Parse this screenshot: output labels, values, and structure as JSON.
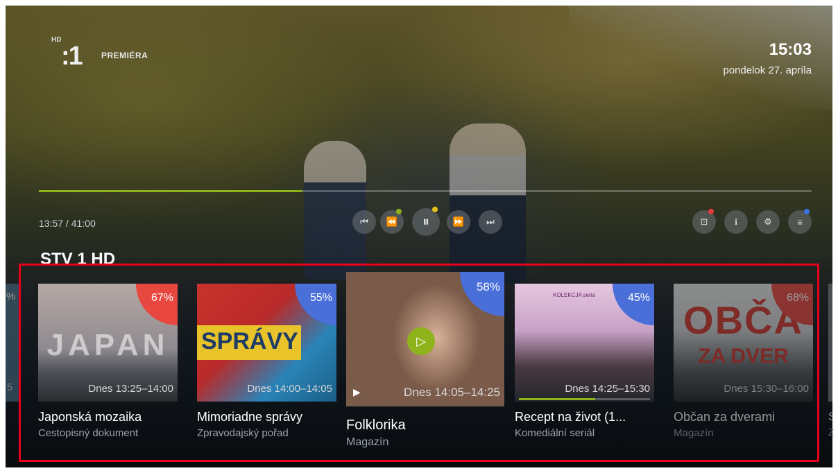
{
  "channel": {
    "hd_badge": "HD",
    "logo": ":1",
    "name": "PREMIÉRA"
  },
  "clock": {
    "time": "15:03",
    "date": "pondelok 27. apríla"
  },
  "player": {
    "position_text": "13:57 / 41:00",
    "progress_fraction": 0.34,
    "controls": [
      {
        "name": "skip-previous-button",
        "glyph": "⏮"
      },
      {
        "name": "rewind-button",
        "glyph": "⏪"
      },
      {
        "name": "pause-button",
        "glyph": "⏸"
      },
      {
        "name": "fast-forward-button",
        "glyph": "⏩"
      },
      {
        "name": "skip-next-button",
        "glyph": "⏭"
      }
    ],
    "right_controls": [
      {
        "name": "record-button",
        "glyph": "⊡",
        "dot_color": "#e23b3b"
      },
      {
        "name": "info-button",
        "glyph": "i"
      },
      {
        "name": "settings-button",
        "glyph": "⚙"
      },
      {
        "name": "menu-button",
        "glyph": "≡",
        "dot_color": "#3a74e0"
      }
    ],
    "dot_colors": {
      "rewind": "#8fb31a",
      "pause": "#e6c21a"
    }
  },
  "section": {
    "title": "STV 1 HD"
  },
  "carousel": {
    "edge_left": {
      "pct": "%",
      "schedule": "5"
    },
    "edge_right": {
      "title": "S",
      "sub": "Z"
    },
    "items": [
      {
        "title": "Japonská mozaika",
        "subtitle": "Cestopisný dokument",
        "schedule": "Dnes 13:25–14:00",
        "percent": "67%",
        "badge_color": "#e8473f",
        "art_text": "JAPAN"
      },
      {
        "title": "Mimoriadne správy",
        "subtitle": "Zpravodajský pořad",
        "schedule": "Dnes 14:00–14:05",
        "percent": "55%",
        "badge_color": "#4a6fd8",
        "art_text": "SPRÁVY"
      },
      {
        "title": "Folklorika",
        "subtitle": "Magazín",
        "schedule": "Dnes 14:05–14:25",
        "percent": "58%",
        "badge_color": "#4a6fd8"
      },
      {
        "title": "Recept na život (1...",
        "subtitle": "Komediální seriál",
        "schedule": "Dnes 14:25–15:30",
        "percent": "45%",
        "badge_color": "#4a6fd8",
        "progress_fraction": 0.58,
        "art_text": "KOLEKCJA  seria"
      },
      {
        "title": "Občan za dverami",
        "subtitle": "Magazín",
        "schedule": "Dnes 15:30–16:00",
        "percent": "68%",
        "badge_color": "#e8473f",
        "art_text": "OBČA",
        "art_text2": "ZA DVER"
      }
    ]
  }
}
